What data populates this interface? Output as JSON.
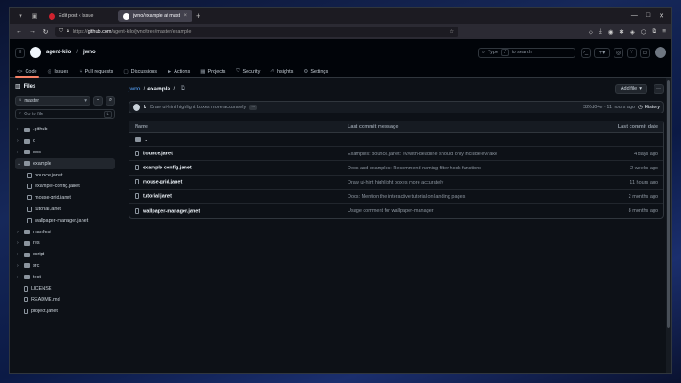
{
  "browser": {
    "tabs": [
      {
        "label": "Edit post ‹ Issue",
        "active": false
      },
      {
        "label": "jwno/example at master · agent-kilo/jwno",
        "active": true
      }
    ],
    "url_prefix": "https://",
    "url_host": "github.com",
    "url_path": "/agent-kilo/jwno/tree/master/example"
  },
  "header": {
    "owner": "agent-kilo",
    "repo": "jwno",
    "search_placeholder": "Type",
    "search_key": "/",
    "search_suffix": "to search"
  },
  "repo_nav": [
    {
      "label": "Code",
      "icon": "code-icon",
      "active": true
    },
    {
      "label": "Issues",
      "icon": "issue-icon"
    },
    {
      "label": "Pull requests",
      "icon": "pull-request-icon"
    },
    {
      "label": "Discussions",
      "icon": "discussion-icon"
    },
    {
      "label": "Actions",
      "icon": "play-icon"
    },
    {
      "label": "Projects",
      "icon": "table-icon"
    },
    {
      "label": "Security",
      "icon": "shield-icon"
    },
    {
      "label": "Insights",
      "icon": "graph-icon"
    },
    {
      "label": "Settings",
      "icon": "gear-icon"
    }
  ],
  "sidebar": {
    "title": "Files",
    "branch": "master",
    "goto_placeholder": "Go to file",
    "goto_key": "t",
    "tree": [
      {
        "label": ".github",
        "type": "folder",
        "expanded": false
      },
      {
        "label": "c",
        "type": "folder",
        "expanded": false
      },
      {
        "label": "doc",
        "type": "folder",
        "expanded": false
      },
      {
        "label": "example",
        "type": "folder",
        "expanded": true,
        "selected": true
      },
      {
        "label": "bounce.janet",
        "type": "file",
        "child": true
      },
      {
        "label": "example-config.janet",
        "type": "file",
        "child": true
      },
      {
        "label": "mouse-grid.janet",
        "type": "file",
        "child": true
      },
      {
        "label": "tutorial.janet",
        "type": "file",
        "child": true
      },
      {
        "label": "wallpaper-manager.janet",
        "type": "file",
        "child": true
      },
      {
        "label": "manifest",
        "type": "folder",
        "expanded": false
      },
      {
        "label": "res",
        "type": "folder",
        "expanded": false
      },
      {
        "label": "script",
        "type": "folder",
        "expanded": false
      },
      {
        "label": "src",
        "type": "folder",
        "expanded": false
      },
      {
        "label": "test",
        "type": "folder",
        "expanded": false
      },
      {
        "label": "LICENSE",
        "type": "file"
      },
      {
        "label": "README.md",
        "type": "file"
      },
      {
        "label": "project.janet",
        "type": "file"
      }
    ]
  },
  "main": {
    "repo_link": "jwno",
    "dir": "example",
    "add_file_label": "Add file",
    "commit": {
      "author": "k",
      "message": "Draw ui-hint highlight boxes more accurately",
      "meta": "326d04e · 11 hours ago",
      "history_label": "History"
    },
    "table": {
      "headers": {
        "name": "Name",
        "message": "Last commit message",
        "date": "Last commit date"
      },
      "parent_label": "..",
      "rows": [
        {
          "name": "bounce.janet",
          "message": "Examples: bounce.janet: ev/with-deadline should only include ev/take",
          "date": "4 days ago"
        },
        {
          "name": "example-config.janet",
          "message": "Docs and examples: Recommend naming filter hook functions",
          "date": "2 weeks ago"
        },
        {
          "name": "mouse-grid.janet",
          "message": "Draw ui-hint highlight boxes more accurately",
          "date": "11 hours ago"
        },
        {
          "name": "tutorial.janet",
          "message": "Docs: Mention the interactive tutorial on landing pages",
          "date": "2 months ago"
        },
        {
          "name": "wallpaper-manager.janet",
          "message": "Usage comment for wallpaper-manager",
          "date": "8 months ago"
        }
      ]
    }
  }
}
